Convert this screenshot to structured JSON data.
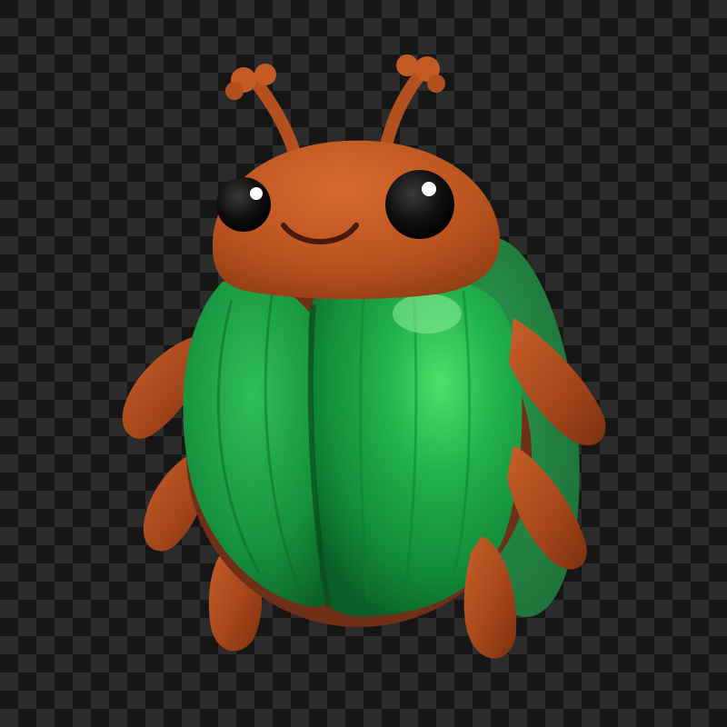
{
  "scene": {
    "subject": "beetle-mascot",
    "background": "transparency-checkerboard",
    "colors": {
      "checker_dark": "#161616",
      "checker_light": "#2b2b2b",
      "shell_green": "#1ea04a",
      "shell_green_dark": "#0e6e2e",
      "head_brown": "#b8521f",
      "leg_brown": "#a8481c",
      "eye_black": "#0b0b0b"
    }
  }
}
